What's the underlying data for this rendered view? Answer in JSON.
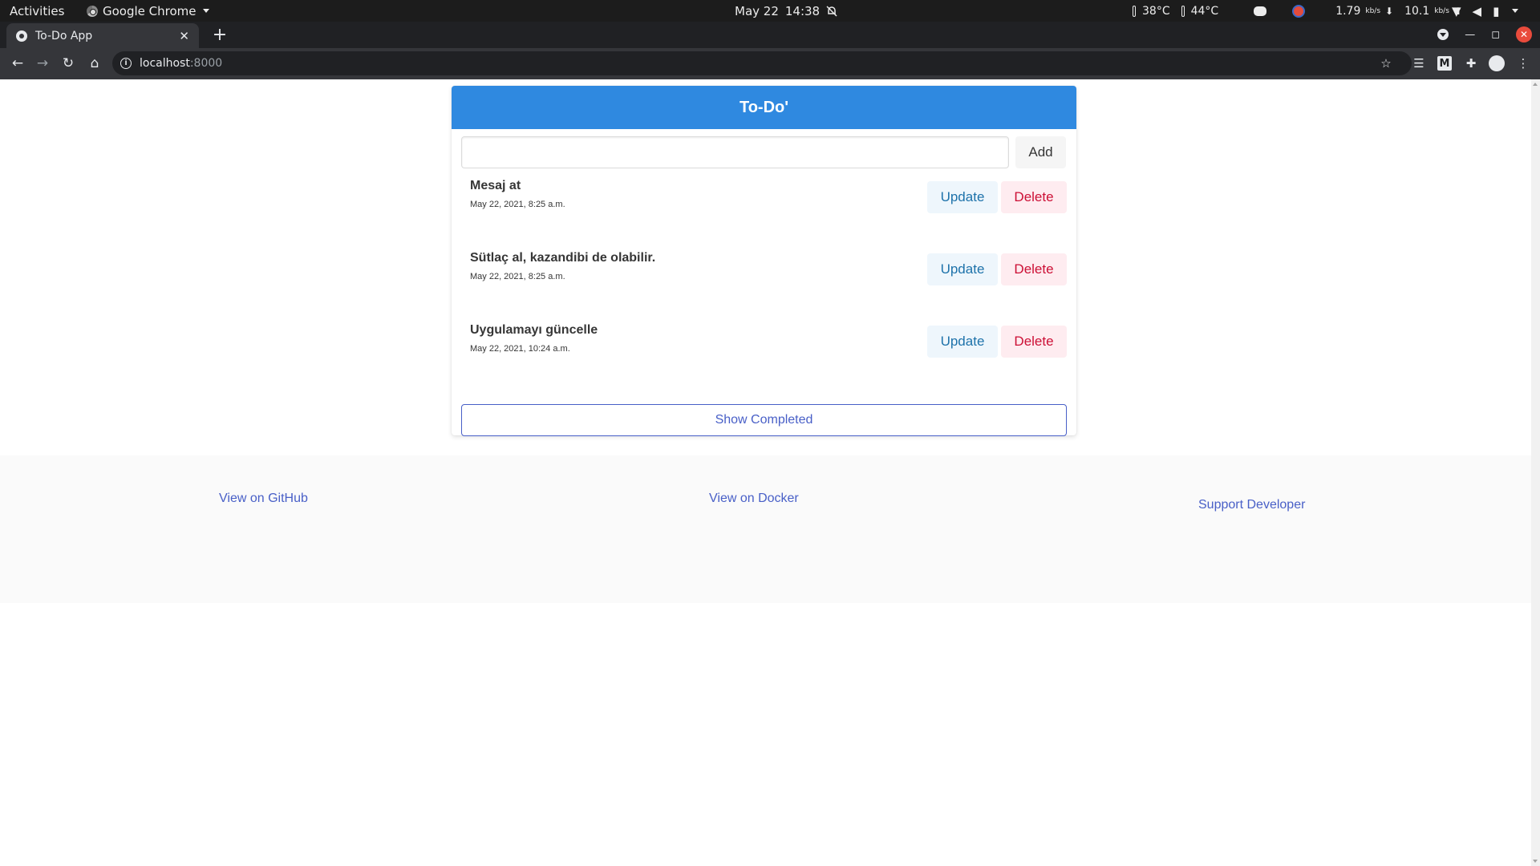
{
  "system_bar": {
    "activities": "Activities",
    "app_name": "Google Chrome",
    "date": "May 22",
    "time": "14:38",
    "temp1": "38°C",
    "temp2": "44°C",
    "net_down": "1.79",
    "net_down_unit": "kb/s",
    "net_up": "10.1",
    "net_up_unit": "kb/s"
  },
  "browser": {
    "tab_title": "To-Do App",
    "new_tab": "+",
    "url_host": "localhost",
    "url_port": ":8000"
  },
  "app": {
    "title": "To-Do'",
    "input": {
      "value": "",
      "placeholder": ""
    },
    "add_label": "Add",
    "todos": [
      {
        "title": "Mesaj at",
        "date": "May 22, 2021, 8:25 a.m.",
        "update_label": "Update",
        "delete_label": "Delete"
      },
      {
        "title": "Sütlaç al, kazandibi de olabilir.",
        "date": "May 22, 2021, 8:25 a.m.",
        "update_label": "Update",
        "delete_label": "Delete"
      },
      {
        "title": "Uygulamayı güncelle",
        "date": "May 22, 2021, 10:24 a.m.",
        "update_label": "Update",
        "delete_label": "Delete"
      }
    ],
    "show_completed_label": "Show Completed"
  },
  "footer": {
    "github": "View on GitHub",
    "docker": "View on Docker",
    "support": "Support Developer"
  },
  "colors": {
    "header": "#2f89e0",
    "link": "#485fc7",
    "update_bg": "#eef6fc",
    "update_text": "#1d72aa",
    "delete_bg": "#feecf0",
    "delete_text": "#cc0f35"
  }
}
